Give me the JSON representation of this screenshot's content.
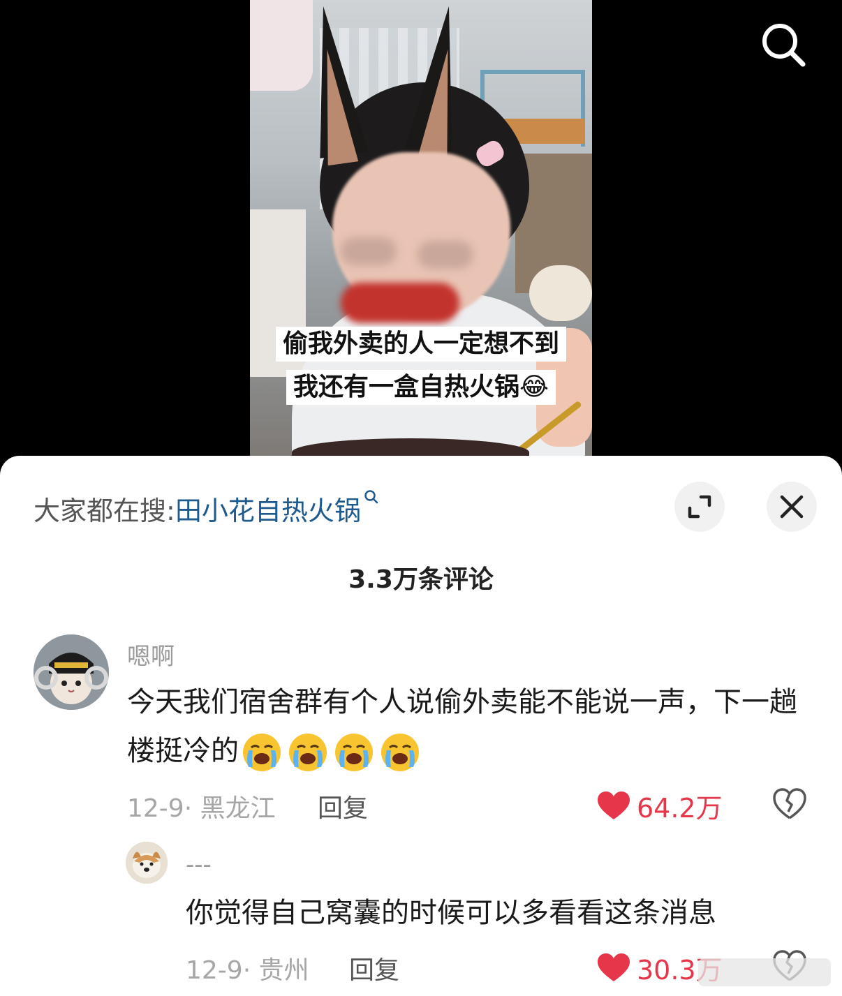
{
  "video": {
    "caption_line1": "偷我外卖的人一定想不到",
    "caption_line2": "我还有一盒自热火锅😂",
    "search_icon": "search-icon"
  },
  "trending": {
    "prefix": "大家都在搜:",
    "term": "田小花自热火锅"
  },
  "comments_header": {
    "count_text": "3.3万条评论"
  },
  "comments": [
    {
      "username": "嗯啊",
      "text": "今天我们宿舍群有个人说偷外卖能不能说一声，下一趟楼挺冷的",
      "emoji_count": 4,
      "date_location": "12-9· 黑龙江",
      "reply_label": "回复",
      "likes": "64.2万"
    },
    {
      "username": "---",
      "text": "你觉得自己窝囊的时候可以多看看这条消息",
      "date_location": "12-9· 贵州",
      "reply_label": "回复",
      "likes": "30.3万"
    }
  ],
  "colors": {
    "like": "#e5364a",
    "trending_term": "#1e5a8e",
    "muted_text": "#a6a6a6"
  }
}
